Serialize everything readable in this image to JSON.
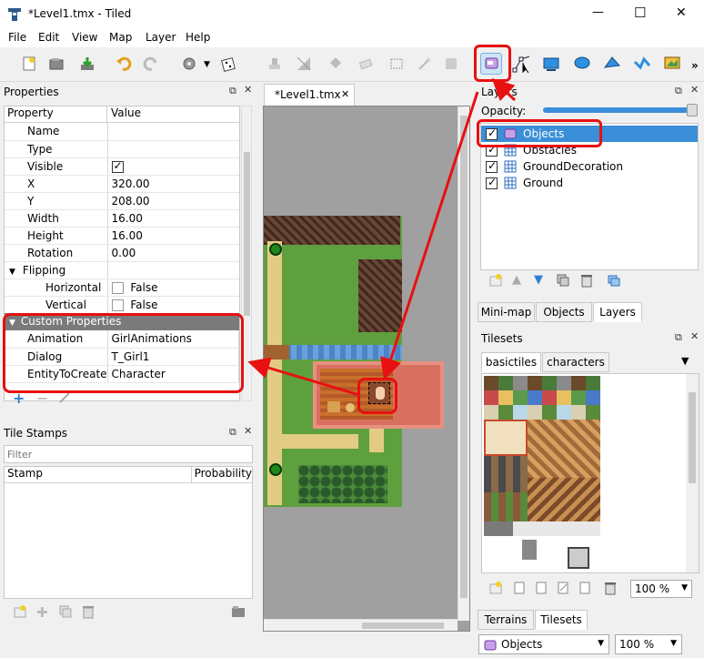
{
  "window": {
    "title": "*Level1.tmx - Tiled",
    "minimize": "—",
    "maximize": "☐",
    "close": "✕"
  },
  "menu": [
    "File",
    "Edit",
    "View",
    "Map",
    "Layer",
    "Help"
  ],
  "properties_panel": {
    "title": "Properties",
    "col_property": "Property",
    "col_value": "Value",
    "rows": [
      {
        "name": "Name",
        "value": ""
      },
      {
        "name": "Type",
        "value": ""
      },
      {
        "name": "Visible",
        "value": ""
      },
      {
        "name": "X",
        "value": "320.00"
      },
      {
        "name": "Y",
        "value": "208.00"
      },
      {
        "name": "Width",
        "value": "16.00"
      },
      {
        "name": "Height",
        "value": "16.00"
      },
      {
        "name": "Rotation",
        "value": "0.00"
      },
      {
        "name": "Flipping",
        "value": ""
      },
      {
        "name": "Horizontal",
        "value": "False"
      },
      {
        "name": "Vertical",
        "value": "False"
      }
    ],
    "custom_header": "Custom Properties",
    "custom_rows": [
      {
        "name": "Animation",
        "value": "GirlAnimations"
      },
      {
        "name": "Dialog",
        "value": "T_Girl1"
      },
      {
        "name": "EntityToCreate",
        "value": "Character"
      }
    ]
  },
  "tile_stamps": {
    "title": "Tile Stamps",
    "filter_placeholder": "Filter",
    "col_stamp": "Stamp",
    "col_probability": "Probability"
  },
  "map_tab": {
    "label": "*Level1.tmx"
  },
  "layers_panel": {
    "title": "Layers",
    "opacity_label": "Opacity:",
    "layers": [
      "Objects",
      "Obstacles",
      "GroundDecoration",
      "Ground"
    ]
  },
  "middle_tabs": [
    "Mini-map",
    "Objects",
    "Layers"
  ],
  "tilesets_panel": {
    "title": "Tilesets",
    "tabs": [
      "basictiles",
      "characters"
    ],
    "zoom": "100 %"
  },
  "bottom_tabs": [
    "Terrains",
    "Tilesets"
  ],
  "status": {
    "layer_select": "Objects",
    "zoom": "100 %"
  },
  "colors": {
    "highlight": "#3b8fd8",
    "annotation_red": "#e81010",
    "custom_header_bg": "#7a7a7a"
  }
}
